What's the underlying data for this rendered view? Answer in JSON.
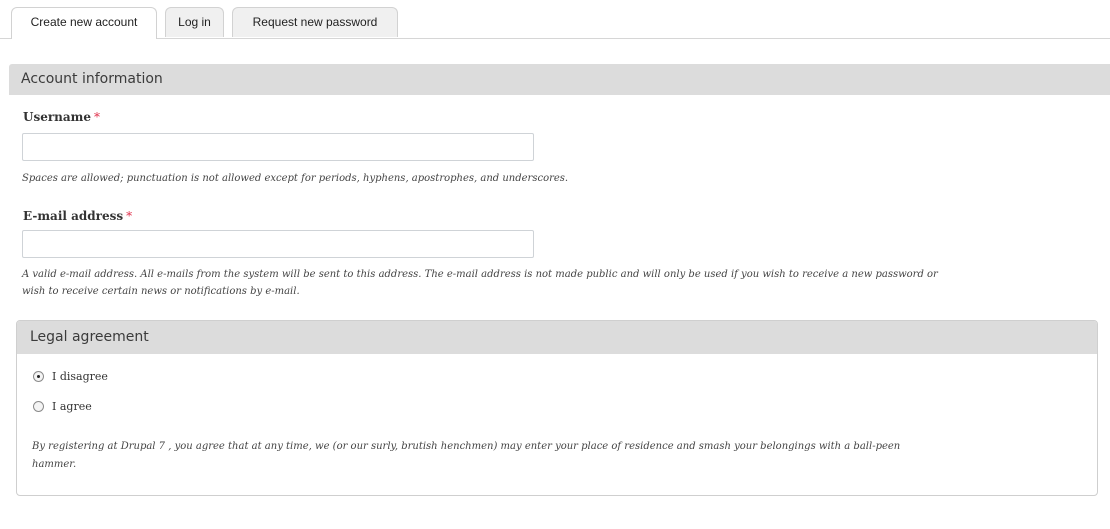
{
  "tabs": [
    {
      "label": "Create new account",
      "active": true
    },
    {
      "label": "Log in",
      "active": false
    },
    {
      "label": "Request new password",
      "active": false
    }
  ],
  "account": {
    "legend": "Account information",
    "username": {
      "label": "Username",
      "required_mark": "*",
      "value": "",
      "placeholder": "",
      "description": "Spaces are allowed; punctuation is not allowed except for periods, hyphens, apostrophes, and underscores."
    },
    "email": {
      "label": "E-mail address",
      "required_mark": "*",
      "value": "",
      "placeholder": "",
      "description_line1": "A valid e-mail address. All e-mails from the system will be sent to this address. The e-mail address is not made public and will only be used if you wish to receive a new password or",
      "description_line2": "wish to receive certain news or notifications by e-mail."
    }
  },
  "legal": {
    "legend": "Legal agreement",
    "options": [
      {
        "label": "I disagree",
        "checked": true
      },
      {
        "label": "I agree",
        "checked": false
      }
    ],
    "description_line1": "By registering at Drupal 7 , you agree that at any time, we (or our surly, brutish henchmen) may enter your place of residence and smash your belongings with a ball-peen",
    "description_line2": "hammer."
  },
  "colors": {
    "legend_bg": "#dcdcdc",
    "required": "#e0314c",
    "border": "#cfcfcf"
  }
}
